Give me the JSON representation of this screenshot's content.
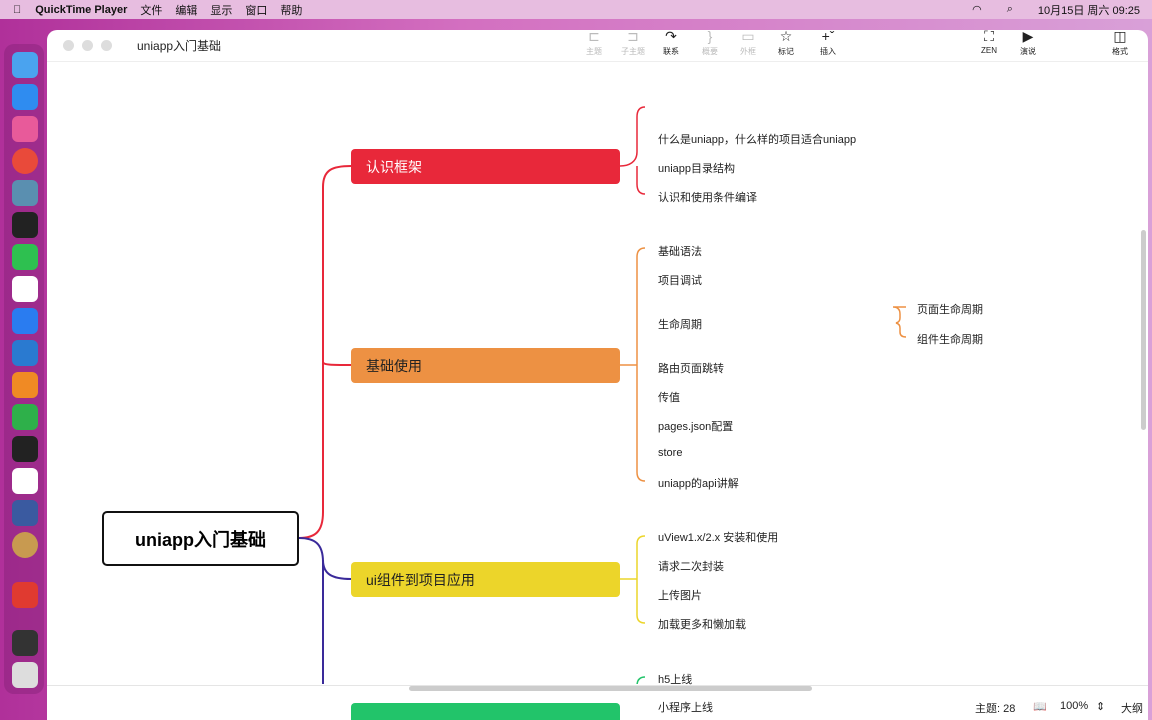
{
  "menubar": {
    "app": "QuickTime Player",
    "items": [
      "文件",
      "编辑",
      "显示",
      "窗口",
      "帮助"
    ],
    "datetime": "10月15日 周六 09:25"
  },
  "window": {
    "title": "uniapp入门基础"
  },
  "toolbar": {
    "topic": "主题",
    "subtopic": "子主题",
    "relation": "联系",
    "summary": "概要",
    "boundary": "外框",
    "marker": "标记",
    "insert": "插入",
    "zen": "ZEN",
    "pitch": "演说",
    "format": "格式"
  },
  "map": {
    "central": "uniapp入门基础",
    "branches": [
      {
        "label": "认识框架",
        "color": "#e8283a",
        "children": [
          "什么是uniapp，什么样的项目适合uniapp",
          "uniapp目录结构",
          "认识和使用条件编译"
        ]
      },
      {
        "label": "基础使用",
        "color": "#ed9143",
        "children": [
          "基础语法",
          "项目调试",
          "生命周期",
          "路由页面跳转",
          "传值",
          "pages.json配置",
          "store",
          "uniapp的api讲解"
        ],
        "sub": [
          "页面生命周期",
          "组件生命周期"
        ]
      },
      {
        "label": "ui组件到项目应用",
        "color": "#ecd52a",
        "children": [
          "uView1.x/2.x 安装和使用",
          "请求二次封装",
          "上传图片",
          "加载更多和懒加载"
        ]
      },
      {
        "label": "",
        "color": "#22c46a",
        "children": [
          "h5上线",
          "小程序上线"
        ]
      }
    ]
  },
  "status": {
    "topics": "主题: 28",
    "zoom": "100%",
    "outline": "大纲"
  }
}
